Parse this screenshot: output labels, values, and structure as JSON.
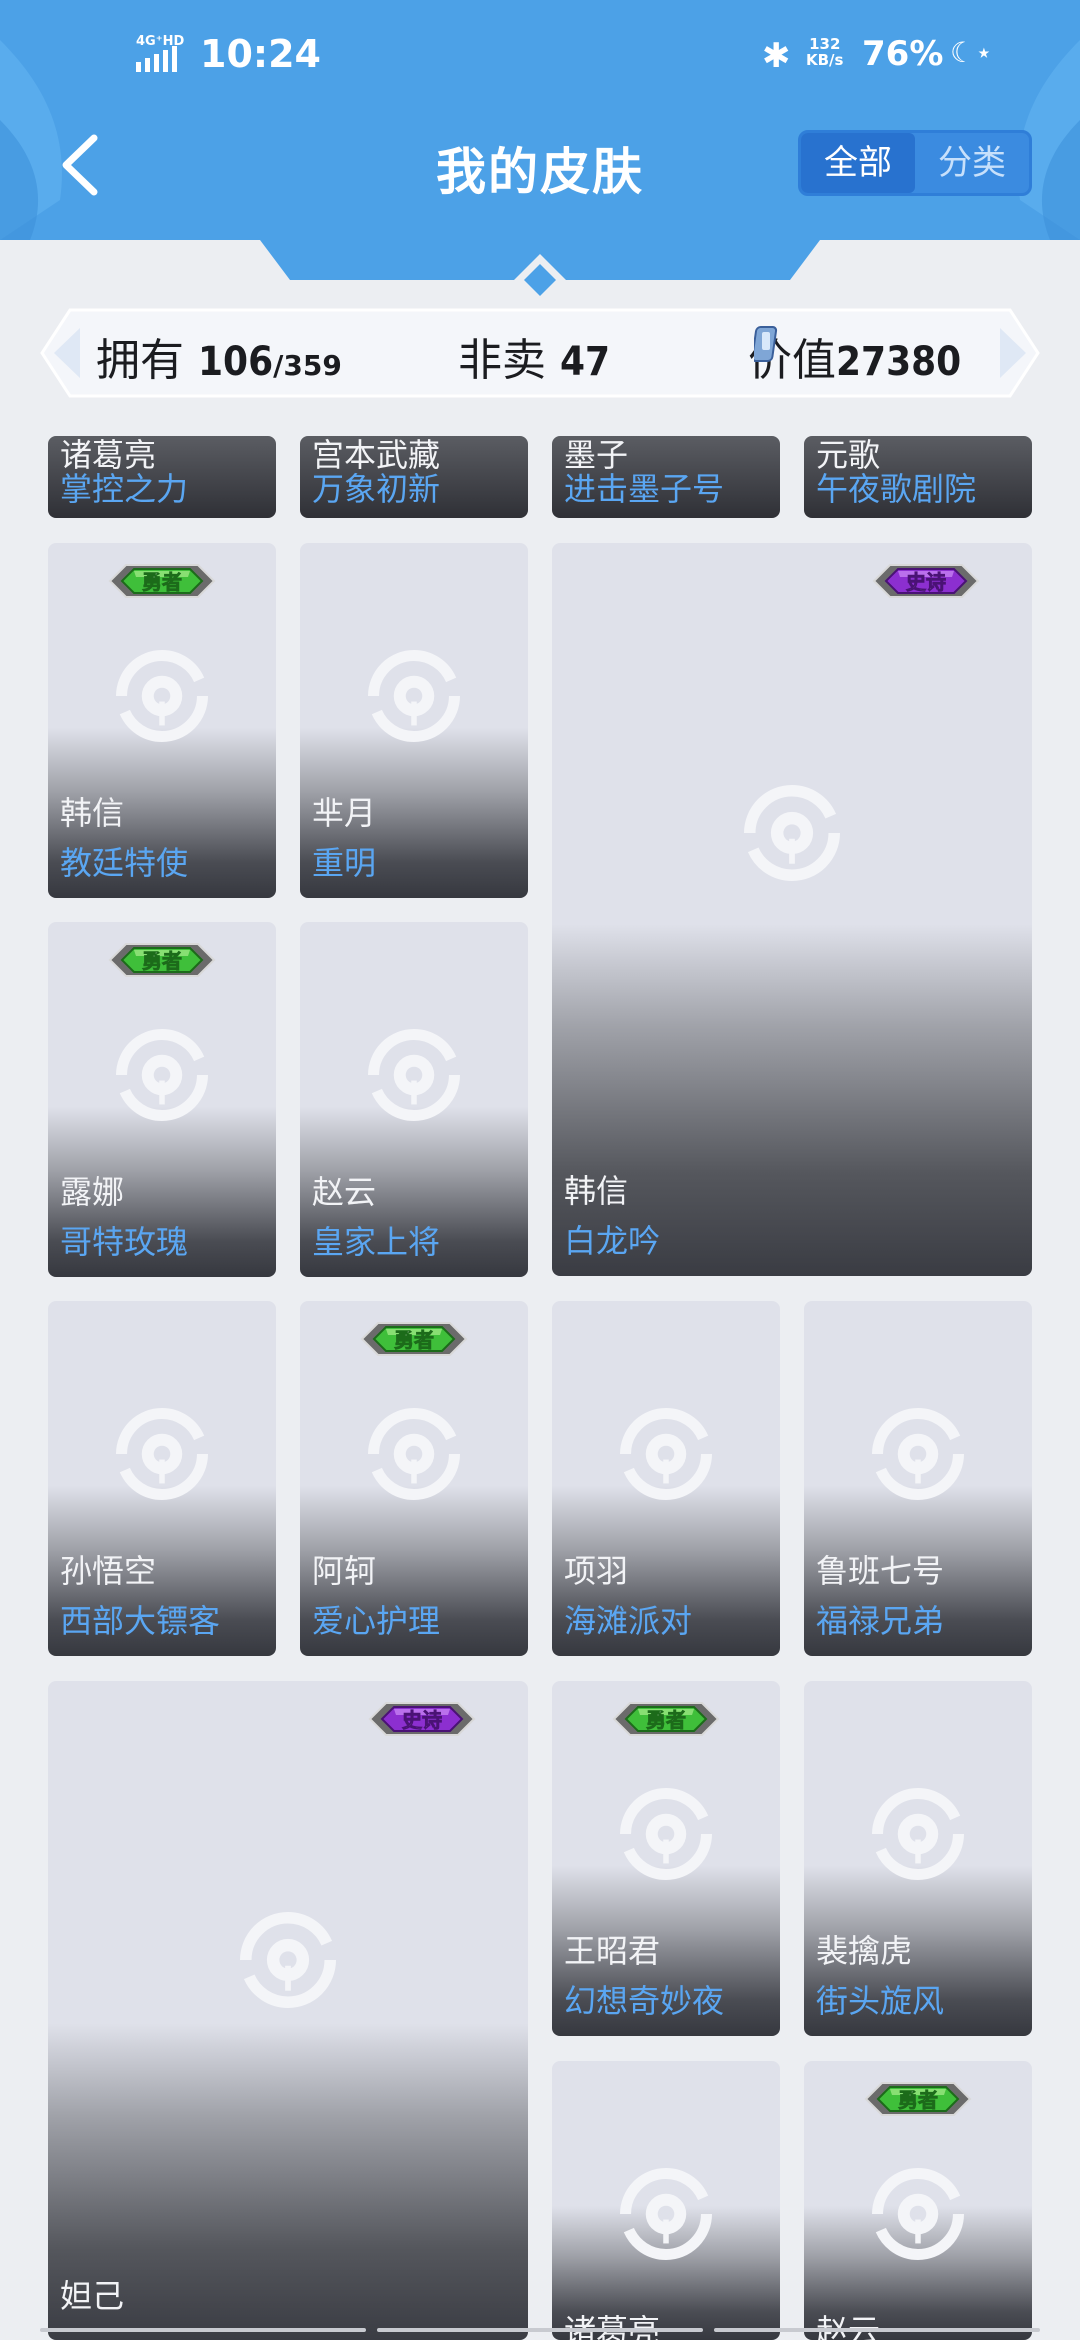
{
  "status_bar": {
    "network": "4G⁺HD",
    "time": "10:24",
    "speed_value": "132",
    "speed_unit": "KB/s",
    "battery": "76%",
    "bluetooth_icon": "bluetooth-icon",
    "moon_icon": "do-not-disturb-icon"
  },
  "header": {
    "title": "我的皮肤",
    "back_icon": "chevron-left-icon",
    "tabs": [
      {
        "label": "全部",
        "active": true
      },
      {
        "label": "分类",
        "active": false
      }
    ]
  },
  "stats": {
    "own_label": "拥有",
    "own_value": "106",
    "own_total": "/359",
    "nonsale_label": "非卖",
    "nonsale_value": "47",
    "worth_label": "价值",
    "worth_value": "27380"
  },
  "badges": {
    "hero": "勇者",
    "epic": "史诗"
  },
  "cards": [
    {
      "hero": "诸葛亮",
      "skin": "掌控之力",
      "badge": ""
    },
    {
      "hero": "宫本武藏",
      "skin": "万象初新",
      "badge": ""
    },
    {
      "hero": "墨子",
      "skin": "进击墨子号",
      "badge": ""
    },
    {
      "hero": "元歌",
      "skin": "午夜歌剧院",
      "badge": ""
    },
    {
      "hero": "韩信",
      "skin": "教廷特使",
      "badge": "勇者"
    },
    {
      "hero": "芈月",
      "skin": "重明",
      "badge": ""
    },
    {
      "hero": "韩信",
      "skin": "白龙吟",
      "badge": "史诗"
    },
    {
      "hero": "露娜",
      "skin": "哥特玫瑰",
      "badge": "勇者"
    },
    {
      "hero": "赵云",
      "skin": "皇家上将",
      "badge": ""
    },
    {
      "hero": "孙悟空",
      "skin": "西部大镖客",
      "badge": ""
    },
    {
      "hero": "阿轲",
      "skin": "爱心护理",
      "badge": "勇者"
    },
    {
      "hero": "项羽",
      "skin": "海滩派对",
      "badge": ""
    },
    {
      "hero": "鲁班七号",
      "skin": "福禄兄弟",
      "badge": ""
    },
    {
      "hero": "妲己",
      "skin": "",
      "badge": "史诗"
    },
    {
      "hero": "王昭君",
      "skin": "幻想奇妙夜",
      "badge": "勇者"
    },
    {
      "hero": "裴擒虎",
      "skin": "街头旋风",
      "badge": ""
    },
    {
      "hero": "诸葛亮",
      "skin": "",
      "badge": ""
    },
    {
      "hero": "赵云",
      "skin": "",
      "badge": "勇者"
    }
  ],
  "colors": {
    "header_blue": "#4c9fe6",
    "skin_name_blue": "#5aa6f2",
    "hero_badge_green": "#3fbf3a",
    "epic_badge_purple": "#8c2fd0"
  }
}
